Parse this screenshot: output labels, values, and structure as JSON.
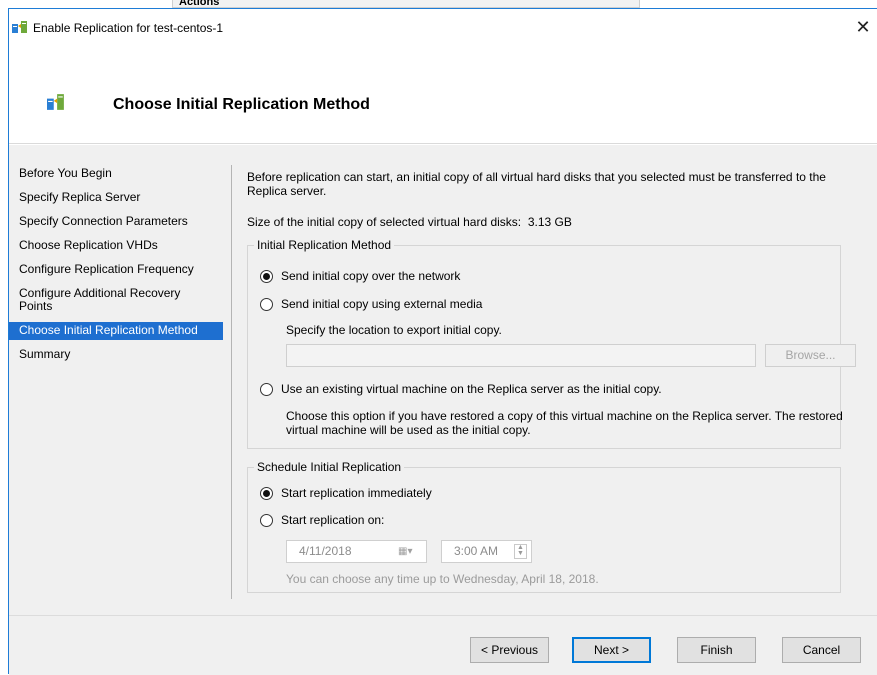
{
  "background": {
    "actions_label": "Actions"
  },
  "window": {
    "title": "Enable Replication for test-centos-1",
    "close_glyph": "✕"
  },
  "header": {
    "title": "Choose Initial Replication Method"
  },
  "nav": {
    "items": [
      {
        "label": "Before You Begin"
      },
      {
        "label": "Specify Replica Server"
      },
      {
        "label": "Specify Connection Parameters"
      },
      {
        "label": "Choose Replication VHDs"
      },
      {
        "label": "Configure Replication Frequency"
      },
      {
        "label": "Configure Additional Recovery Points"
      },
      {
        "label": "Choose Initial Replication Method",
        "active": true
      },
      {
        "label": "Summary"
      }
    ]
  },
  "content": {
    "intro": "Before replication can start, an initial copy of all virtual hard disks that you selected must be transferred to the Replica server.",
    "size_label": "Size of the initial copy of selected virtual hard disks:",
    "size_value": "3.13 GB",
    "method_group": {
      "legend": "Initial Replication Method",
      "option_network": "Send initial copy over the network",
      "option_external": "Send initial copy using external media",
      "export_location_label": "Specify the location to export initial copy.",
      "export_path_value": "",
      "browse_label": "Browse...",
      "option_existing_vm": "Use an existing virtual machine on the Replica server as the initial copy.",
      "existing_vm_note": "Choose this option if you have restored a copy of this virtual machine on the Replica server. The restored virtual machine will be used as the initial copy.",
      "selected": "network"
    },
    "schedule_group": {
      "legend": "Schedule Initial Replication",
      "option_immediately": "Start replication immediately",
      "option_on": "Start replication on:",
      "date_value": "4/11/2018",
      "time_value": "3:00 AM",
      "hint": "You can choose any time up to Wednesday, April 18, 2018.",
      "selected": "immediately"
    }
  },
  "footer": {
    "previous_label": "< Previous",
    "next_label": "Next >",
    "finish_label": "Finish",
    "cancel_label": "Cancel"
  },
  "colors": {
    "accent": "#1e6fd0",
    "window_border": "#1e7cd6",
    "panel_bg": "#f0f0f0"
  }
}
